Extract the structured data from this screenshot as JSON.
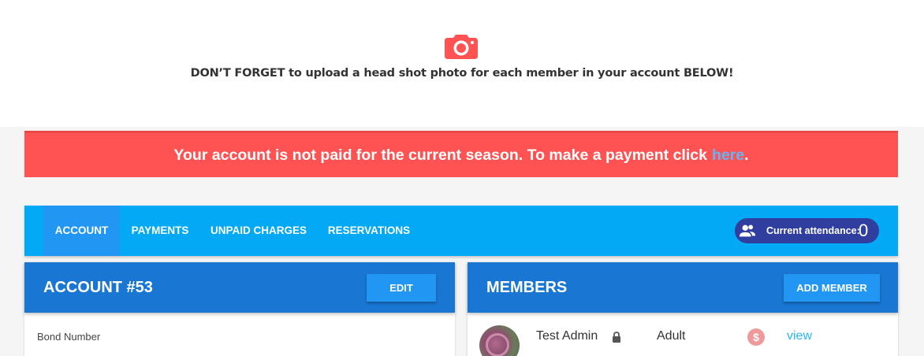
{
  "reminder": {
    "icon": "camera-icon",
    "icon_color": "#ff5252",
    "text": "DON’T FORGET to upload a head shot photo for each member in your account BELOW!"
  },
  "alert": {
    "message": "Your account is not paid for the current season. To make a payment click",
    "link_label": "here",
    "suffix": ".",
    "background": "#ff5252"
  },
  "tabs": [
    {
      "label": "ACCOUNT",
      "active": true
    },
    {
      "label": "PAYMENTS",
      "active": false
    },
    {
      "label": "UNPAID CHARGES",
      "active": false
    },
    {
      "label": "RESERVATIONS",
      "active": false
    }
  ],
  "attendance": {
    "icon": "people-icon",
    "label": "Current attendance:",
    "count": "0"
  },
  "account_card": {
    "title": "ACCOUNT #53",
    "edit_label": "EDIT",
    "fields": [
      {
        "label": "Bond Number"
      }
    ]
  },
  "members_card": {
    "title": "MEMBERS",
    "add_label": "ADD MEMBER",
    "members": [
      {
        "name": "Test Admin",
        "type": "Adult",
        "payment_icon": "dollar-icon",
        "payment_symbol": "$",
        "view_label": "view"
      }
    ]
  },
  "colors": {
    "tab_bar": "#03a9f4",
    "tab_active": "#2196f3",
    "card_header": "#1976d2",
    "badge": "#303f9f",
    "link": "#29b6f6"
  }
}
